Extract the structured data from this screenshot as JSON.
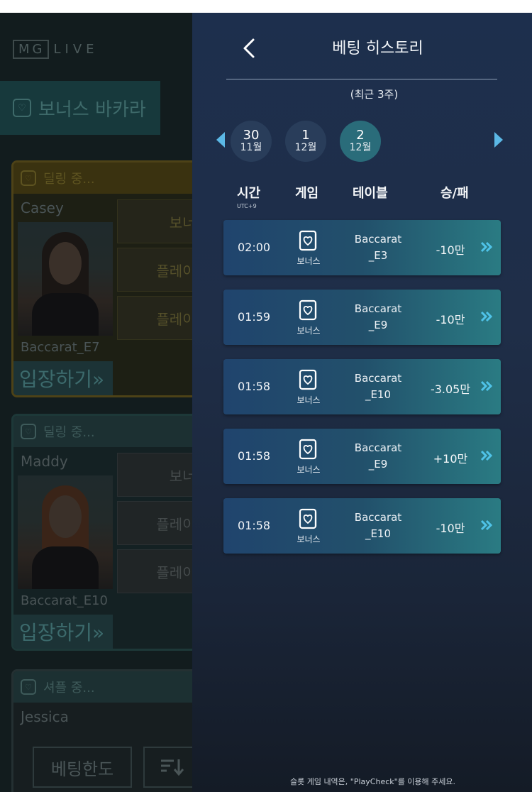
{
  "lobby": {
    "logo_mg": "MG",
    "logo_live": "LIVE",
    "active_tab": "보너스 바카라",
    "cards": [
      {
        "status": "딜링 중...",
        "dealer": "Casey",
        "table": "Baccarat_E7",
        "cell_a": "보너스",
        "cell_b": "플레이어",
        "cell_c": "플레이어",
        "enter": "입장하기»"
      },
      {
        "status": "딜링 중...",
        "dealer": "Maddy",
        "table": "Baccarat_E10",
        "cell_a": "보너스",
        "cell_b": "플레이어",
        "cell_c": "플레이어",
        "enter": "입장하기»"
      },
      {
        "status": "셔플 중...",
        "dealer": "Jessica"
      }
    ],
    "bet_limit_button": "베팅한도",
    "sort_button_icon": "sort-icon"
  },
  "panel": {
    "title": "베팅 히스토리",
    "period": "(최근 3주)",
    "dates": [
      {
        "day": "30",
        "month": "11월",
        "active": false
      },
      {
        "day": "1",
        "month": "12월",
        "active": false
      },
      {
        "day": "2",
        "month": "12월",
        "active": true
      }
    ],
    "columns": {
      "time": "시간",
      "timezone": "UTC+9",
      "game": "게임",
      "table": "테이블",
      "win_loss": "승/패"
    },
    "rows": [
      {
        "time": "02:00",
        "game": "보너스",
        "table_line1": "Baccarat",
        "table_line2": "_E3",
        "result": "-10만"
      },
      {
        "time": "01:59",
        "game": "보너스",
        "table_line1": "Baccarat",
        "table_line2": "_E9",
        "result": "-10만"
      },
      {
        "time": "01:58",
        "game": "보너스",
        "table_line1": "Baccarat",
        "table_line2": "_E10",
        "result": "-3.05만"
      },
      {
        "time": "01:58",
        "game": "보너스",
        "table_line1": "Baccarat",
        "table_line2": "_E9",
        "result": "+10만"
      },
      {
        "time": "01:58",
        "game": "보너스",
        "table_line1": "Baccarat",
        "table_line2": "_E10",
        "result": "-10만"
      }
    ],
    "footer": "슬롯 게임 내역은, \"PlayCheck\"를 이용해 주세요."
  },
  "colors": {
    "accent": "#5bb8e6",
    "active_chip": "#2a6c7a",
    "chevron": "#4fc3e8"
  }
}
